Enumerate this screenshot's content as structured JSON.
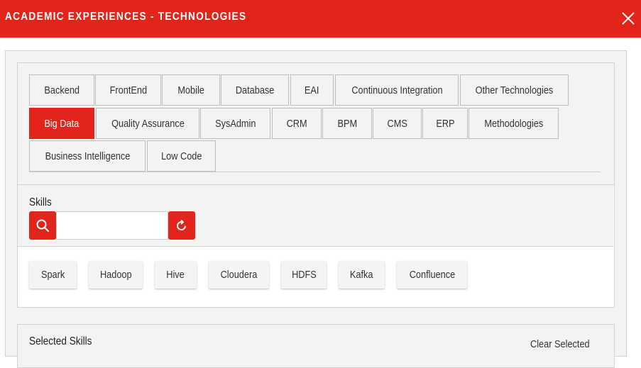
{
  "header": {
    "title": "ACADEMIC EXPERIENCES - TECHNOLOGIES"
  },
  "tabs": [
    {
      "label": "Backend"
    },
    {
      "label": "FrontEnd"
    },
    {
      "label": "Mobile"
    },
    {
      "label": "Database"
    },
    {
      "label": "EAI"
    },
    {
      "label": "Continuous Integration"
    },
    {
      "label": "Other Technologies"
    },
    {
      "label": "Big Data",
      "active": true
    },
    {
      "label": "Quality Assurance"
    },
    {
      "label": "SysAdmin"
    },
    {
      "label": "CRM"
    },
    {
      "label": "BPM"
    },
    {
      "label": "CMS"
    },
    {
      "label": "ERP"
    },
    {
      "label": "Methodologies"
    },
    {
      "label": "Business Intelligence"
    },
    {
      "label": "Low Code"
    }
  ],
  "skills": {
    "label": "Skills",
    "search_value": "",
    "items": [
      "Spark",
      "Hadoop",
      "Hive",
      "Cloudera",
      "HDFS",
      "Kafka",
      "Confluence"
    ]
  },
  "selected": {
    "label": "Selected Skills",
    "clear_label": "Clear Selected"
  },
  "colors": {
    "accent": "#e3241b"
  },
  "icons": {
    "close": "close-icon",
    "search": "search-icon",
    "reset": "refresh-icon"
  }
}
